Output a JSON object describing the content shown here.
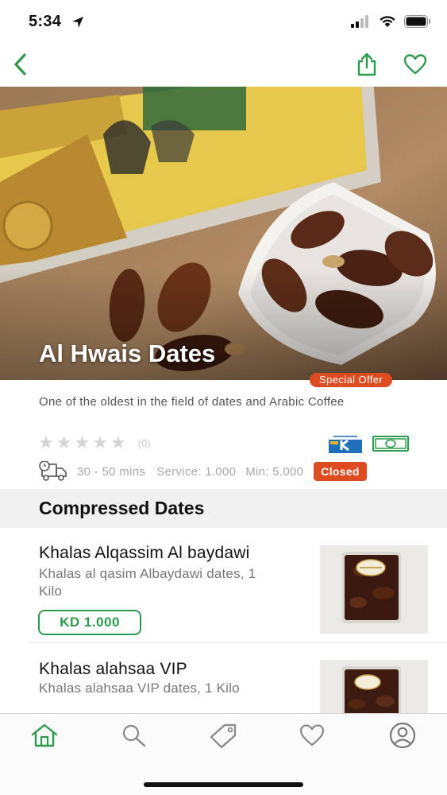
{
  "status_bar": {
    "time": "5:34"
  },
  "nav": {
    "back_icon": "chevron-left-icon",
    "share_icon": "share-icon",
    "favorite_icon": "heart-icon"
  },
  "store": {
    "name": "Al Hwais Dates",
    "badge": "Special Offer",
    "description": "One of the oldest in the field of dates and Arabic Coffee",
    "rating": 0,
    "rating_count": "(0)",
    "payment_methods": [
      "knet",
      "cash"
    ],
    "delivery_time": "30 - 50 mins",
    "service": "Service: 1.000",
    "minimum": "Min: 5.000",
    "status": "Closed"
  },
  "section": {
    "title": "Compressed Dates"
  },
  "items": [
    {
      "name": "Khalas Alqassim Al baydawi",
      "description": " Khalas al qasim Albaydawi dates, 1 Kilo",
      "price": "KD 1.000"
    },
    {
      "name": "Khalas alahsaa VIP",
      "description": " Khalas alahsaa VIP dates, 1 Kilo"
    }
  ],
  "tab_bar": [
    "home-icon",
    "search-icon",
    "tag-icon",
    "heart-icon",
    "profile-icon"
  ],
  "colors": {
    "accent": "#2e9a4f",
    "badge": "#dd4b21",
    "section_bg": "#f0f0f0"
  }
}
